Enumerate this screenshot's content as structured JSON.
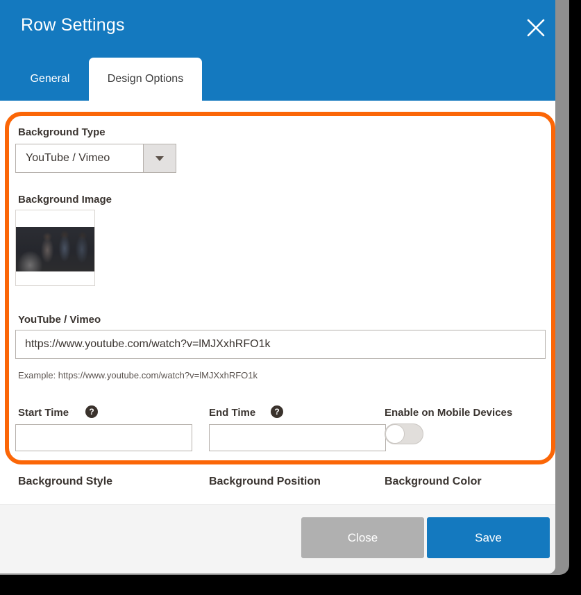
{
  "colors": {
    "header_blue": "#1479bf",
    "highlight_orange": "#fb6607",
    "close_gray": "#b0b0b0",
    "footer_bg": "#f4f4f4",
    "backing_panel": "#8f8f8f"
  },
  "header": {
    "title": "Row Settings",
    "close_icon": "close-icon"
  },
  "tabs": [
    {
      "label": "General",
      "active": false
    },
    {
      "label": "Design Options",
      "active": true
    }
  ],
  "body": {
    "background_type": {
      "label": "Background Type",
      "value": "YouTube / Vimeo",
      "arrow_icon": "chevron-down-icon"
    },
    "background_image": {
      "label": "Background Image",
      "thumbnail_alt": "people working at a desk"
    },
    "video_url": {
      "label": "YouTube / Vimeo",
      "value": "https://www.youtube.com/watch?v=lMJXxhRFO1k",
      "placeholder": "",
      "example": "Example: https://www.youtube.com/watch?v=lMJXxhRFO1k"
    },
    "start_time": {
      "label": "Start Time",
      "value": "",
      "placeholder": "",
      "help_icon": "question-mark-icon"
    },
    "end_time": {
      "label": "End Time",
      "value": "",
      "placeholder": "",
      "help_icon": "question-mark-icon"
    },
    "enable_mobile": {
      "label": "Enable on Mobile Devices",
      "state": "off"
    },
    "bottom_labels": {
      "background_style": "Background Style",
      "background_position": "Background Position",
      "background_color": "Background Color"
    }
  },
  "footer": {
    "close_label": "Close",
    "save_label": "Save"
  }
}
